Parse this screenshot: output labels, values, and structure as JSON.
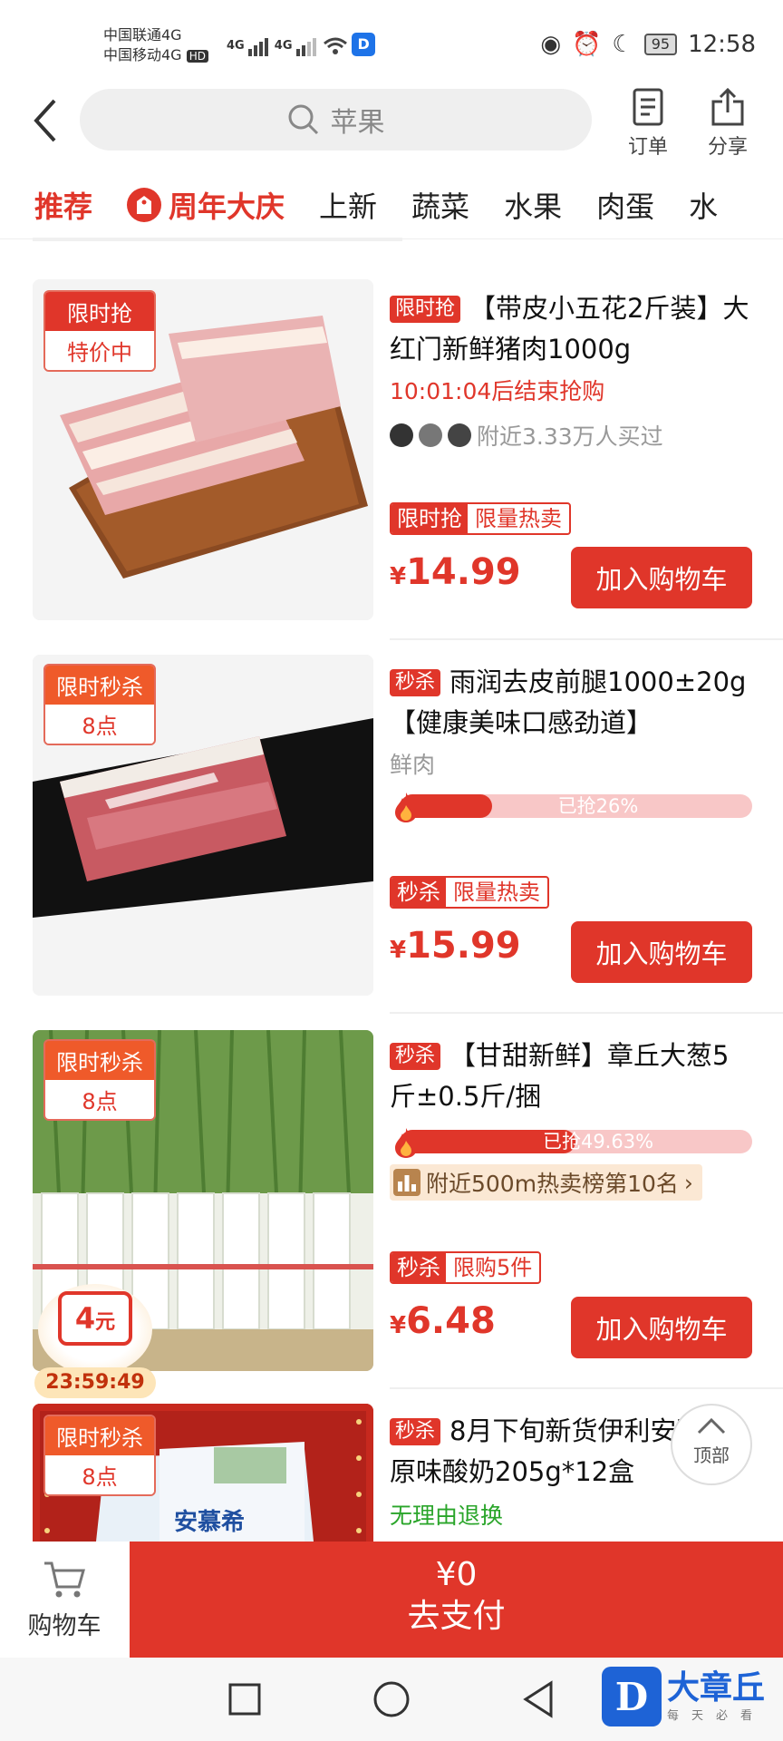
{
  "status": {
    "carrier1": "中国联通4G",
    "carrier2": "中国移动4G",
    "hd": "HD",
    "net1": "4G",
    "net2": "4G",
    "battery": "95",
    "time": "12:58"
  },
  "header": {
    "search_text": "苹果",
    "orders_label": "订单",
    "share_label": "分享"
  },
  "tabs": [
    {
      "label": "推荐"
    },
    {
      "label": "周年大庆"
    },
    {
      "label": "上新"
    },
    {
      "label": "蔬菜"
    },
    {
      "label": "水果"
    },
    {
      "label": "肉蛋"
    },
    {
      "label": "水"
    }
  ],
  "products": [
    {
      "badge_top": "限时抢",
      "badge_bottom": "特价中",
      "tag": "限时抢",
      "title": "【带皮小五花2斤装】大红门新鲜猪肉1000g",
      "countdown": "10:01:04后结束抢购",
      "buyers": "附近3.33万人买过",
      "price_tag_1": "限时抢",
      "price_tag_2": "限量热卖",
      "currency": "¥",
      "price": "14.99",
      "button": "加入购物车"
    },
    {
      "badge_top": "限时秒杀",
      "badge_bottom": "8点",
      "tag": "秒杀",
      "title": "雨润去皮前腿1000±20g【健康美味口感劲道】",
      "category": "鲜肉",
      "progress_text": "已抢26%",
      "progress_pct": 26,
      "price_tag_1": "秒杀",
      "price_tag_2": "限量热卖",
      "currency": "¥",
      "price": "15.99",
      "button": "加入购物车"
    },
    {
      "badge_top": "限时秒杀",
      "badge_bottom": "8点",
      "tag": "秒杀",
      "title": "【甘甜新鲜】章丘大葱5斤±0.5斤/捆",
      "progress_text": "已抢49.63%",
      "progress_pct": 49.63,
      "rank_text": "附近500m热卖榜第10名",
      "price_tag_1": "秒杀",
      "price_tag_2": "限购5件",
      "currency": "¥",
      "price": "6.48",
      "button": "加入购物车"
    },
    {
      "badge_top": "限时秒杀",
      "badge_bottom": "8点",
      "tag": "秒杀",
      "title": "8月下旬新货伊利安慕希原味酸奶205g*12盒",
      "return_policy": "无理由退换",
      "package_text": "安慕希"
    }
  ],
  "coupon_bubble": {
    "amount": "4",
    "unit": "元",
    "timer": "23:59:49"
  },
  "top_button": "顶部",
  "cart": {
    "label": "购物车",
    "total": "¥0",
    "pay_label": "去支付"
  },
  "watermark": {
    "logo_letter": "D",
    "name": "大章丘",
    "slogan": "每天必看"
  },
  "colors": {
    "accent": "#e0362a",
    "brand_blue": "#1e63d6"
  }
}
